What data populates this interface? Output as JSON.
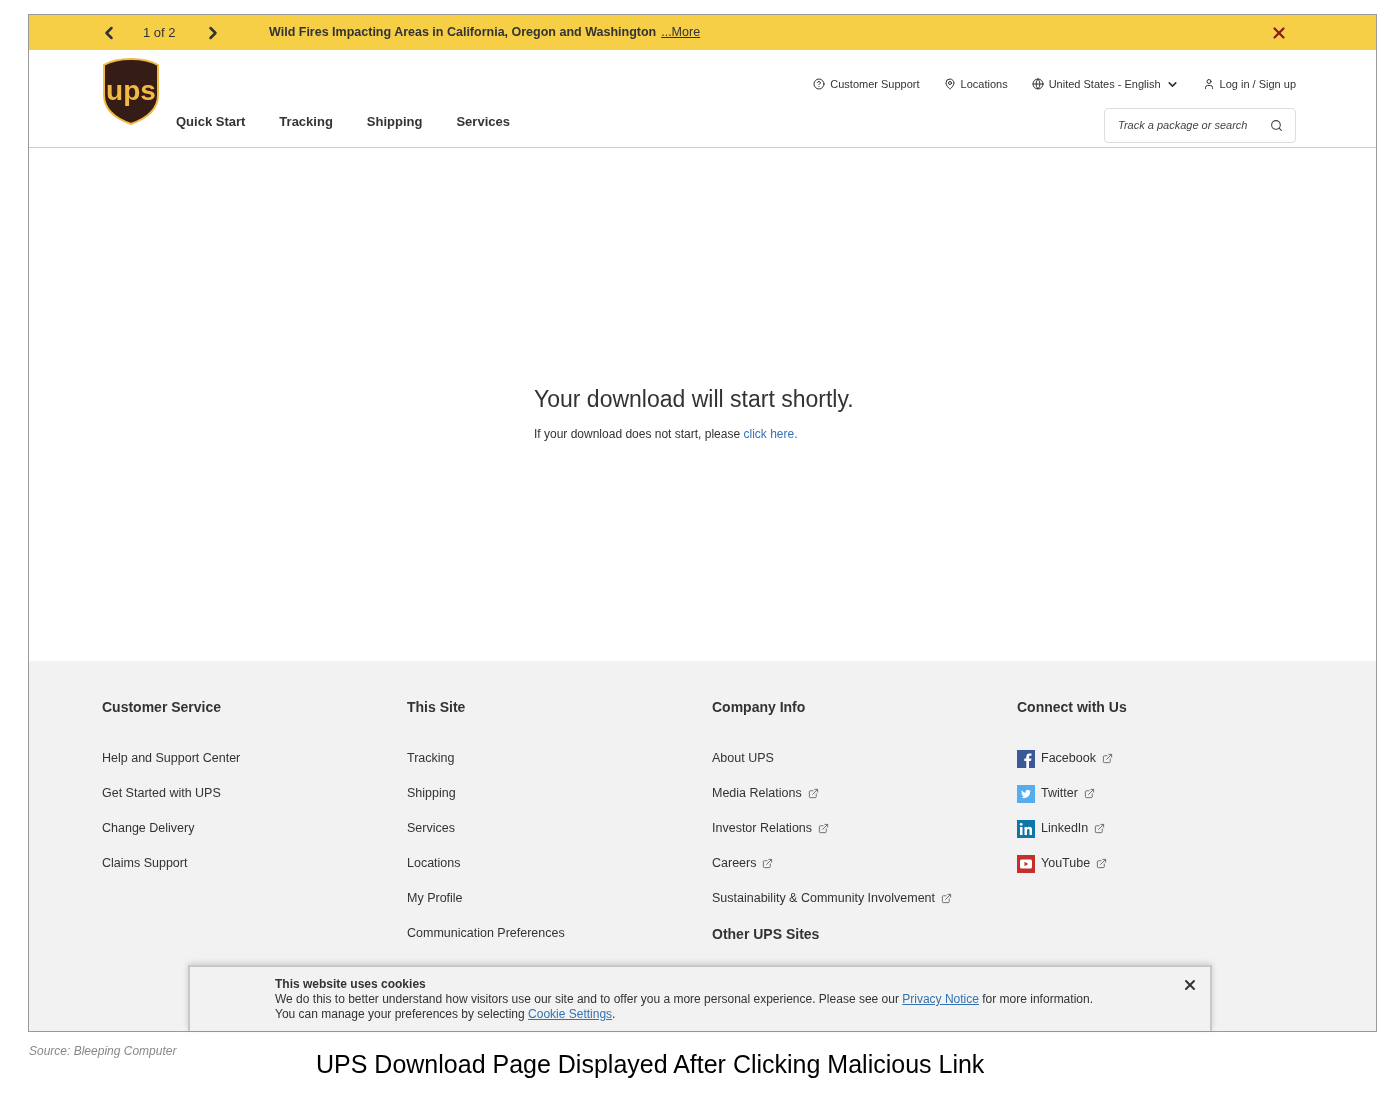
{
  "alert_bar": {
    "pager": "1 of 2",
    "message": "Wild Fires Impacting Areas in California, Oregon and Washington",
    "more_link": "...More"
  },
  "header": {
    "logo": "ups",
    "utility_links": [
      {
        "label": "Customer Support"
      },
      {
        "label": "Locations"
      },
      {
        "label": "United States - English"
      },
      {
        "label": "Log in / Sign up"
      }
    ],
    "nav": [
      {
        "label": "Quick Start"
      },
      {
        "label": "Tracking"
      },
      {
        "label": "Shipping"
      },
      {
        "label": "Services"
      }
    ],
    "search": {
      "placeholder": "Track a package or search"
    }
  },
  "main": {
    "heading": "Your download will start shortly.",
    "note": "If your download does not start, please ",
    "link": "click here."
  },
  "footer": {
    "columns": [
      {
        "title": "Customer Service",
        "links": [
          {
            "label": "Help and Support Center",
            "external": false
          },
          {
            "label": "Get Started with UPS",
            "external": false
          },
          {
            "label": "Change Delivery",
            "external": false
          },
          {
            "label": "Claims Support",
            "external": false
          }
        ]
      },
      {
        "title": "This Site",
        "links": [
          {
            "label": "Tracking",
            "external": false
          },
          {
            "label": "Shipping",
            "external": false
          },
          {
            "label": "Services",
            "external": false
          },
          {
            "label": "Locations",
            "external": false
          },
          {
            "label": "My Profile",
            "external": false
          },
          {
            "label": "Communication Preferences",
            "external": false
          }
        ]
      },
      {
        "title": "Company Info",
        "links": [
          {
            "label": "About UPS",
            "external": false
          },
          {
            "label": "Media Relations",
            "external": true
          },
          {
            "label": "Investor Relations",
            "external": true
          },
          {
            "label": "Careers",
            "external": true
          },
          {
            "label": "Sustainability & Community Involvement",
            "external": true
          }
        ],
        "subtitle": "Other UPS Sites"
      },
      {
        "title": "Connect with Us",
        "links": [
          {
            "label": "Facebook",
            "external": true,
            "kind": "facebook"
          },
          {
            "label": "Twitter",
            "external": true,
            "kind": "twitter"
          },
          {
            "label": "LinkedIn",
            "external": true,
            "kind": "linkedin"
          },
          {
            "label": "YouTube",
            "external": true,
            "kind": "youtube"
          }
        ]
      }
    ]
  },
  "cookie_banner": {
    "title": "This website uses cookies",
    "text_before": "We do this to better understand how visitors use our site and to offer you a more personal experience. Please see our ",
    "privacy_link": "Privacy Notice",
    "text_middle": " for more information. You can manage your preferences by selecting ",
    "settings_link": "Cookie Settings",
    "text_after": "."
  },
  "source": "Source: Bleeping Computer",
  "caption": "UPS Download Page Displayed After Clicking Malicious Link"
}
